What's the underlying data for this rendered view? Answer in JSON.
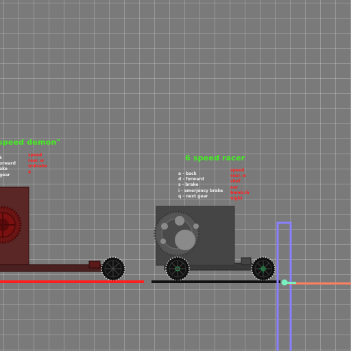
{
  "colors": {
    "title_green": "#44ee22",
    "stat_red": "#ff2020",
    "label_white": "#f0f0f0",
    "background": "#7a7a7a",
    "wall": "#8a80ff",
    "speed_line": "#ff8060"
  },
  "car1": {
    "title": "speed demon\"",
    "controls": [
      "k",
      "orward",
      "ake",
      "gear"
    ],
    "stats": [
      "speed",
      "rear. w",
      "unbrake",
      "4"
    ]
  },
  "car2": {
    "title": "6 speed racer",
    "controls": [
      "a - back",
      "d - forward",
      "s - brake",
      "i - emerjency brake",
      "q - next gear"
    ],
    "stats": [
      "speed",
      "rear. w",
      "shaf",
      "ear",
      "bomb.lb",
      "night"
    ]
  },
  "icons": [
    "wheel-icon",
    "gear-icon",
    "player-marker-icon"
  ]
}
